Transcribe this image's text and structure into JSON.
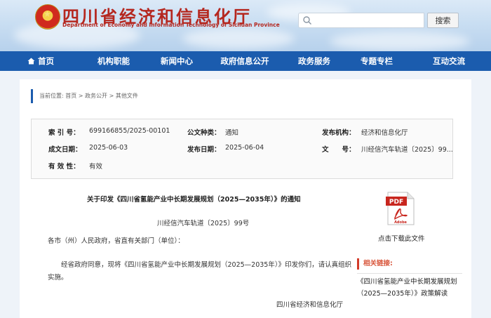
{
  "header": {
    "site_title": "四川省经济和信息化厅",
    "site_subtitle": "Department of Economy and Information Technology of Sichuan Province",
    "search_placeholder": "",
    "search_button": "搜索"
  },
  "nav": {
    "items": [
      "首页",
      "机构职能",
      "新闻中心",
      "政府信息公开",
      "政务服务",
      "专题专栏",
      "互动交流"
    ]
  },
  "breadcrumb": {
    "text": "当前位置: 首页 > 政务公开 > 其他文件"
  },
  "info": {
    "index_label": "索 引 号：",
    "index_value": "699166855/2025-00101",
    "type_label": "公文种类：",
    "type_value": "通知",
    "org_label": "发布机构：",
    "org_value": "经济和信息化厅",
    "created_label": "成文日期：",
    "created_value": "2025-06-03",
    "published_label": "发布日期：",
    "published_value": "2025-06-04",
    "docno_label": "文　　号：",
    "docno_value": "川经信汽车轨道〔2025〕99...",
    "validity_label": "有 效 性：",
    "validity_value": "有效"
  },
  "document": {
    "title": "关于印发《四川省氢能产业中长期发展规划（2025—2035年）》的通知",
    "number": "川经信汽车轨道〔2025〕99号",
    "addressee": "各市（州）人民政府，省直有关部门（单位）：",
    "body": "经省政府同意，现将《四川省氢能产业中长期发展规划（2025—2035年）》印发你们，请认真组织实施。",
    "signature": "四川省经济和信息化厅"
  },
  "sidebar": {
    "pdf_icon_text": "PDF",
    "pdf_brand": "Adobe",
    "download_label": "点击下载此文件",
    "related_heading": "相关链接:",
    "related_links": [
      "《四川省氢能产业中长期发展规划（2025—2035年）》政策解读"
    ]
  },
  "colors": {
    "nav_bg": "#1b5cae",
    "title_red": "#b5271f",
    "related_accent": "#d23b2a"
  }
}
